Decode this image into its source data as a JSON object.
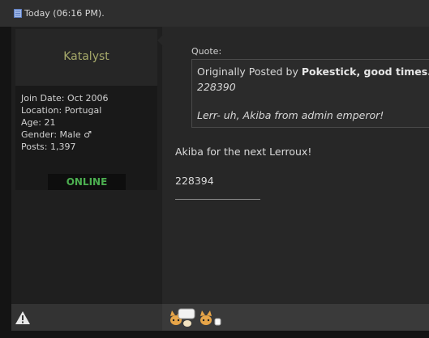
{
  "post": {
    "date": "Today (06:16 PM).",
    "author": {
      "name": "Katalyst",
      "join_date": "Join Date: Oct 2006",
      "location": "Location: Portugal",
      "age": "Age: 21",
      "gender": "Gender: Male ♂",
      "posts": "Posts: 1,397",
      "status": "ONLINE"
    },
    "quote": {
      "label": "Quote:",
      "prefix": "Originally Posted by",
      "author": "Pokestick, good times.",
      "number": "228390",
      "text": "Lerr- uh, Akiba from admin emperor!"
    },
    "body": "Akiba for the next Lerroux!",
    "number": "228394",
    "signature": "__________________"
  },
  "icons": {
    "date": "document-icon",
    "quote_link": "arrow-right-circle-icon",
    "report": "warning-icon",
    "signature_image": "pokemon-smiley-icons"
  },
  "colors": {
    "username": "#a6a96a",
    "online": "#4caf50"
  }
}
